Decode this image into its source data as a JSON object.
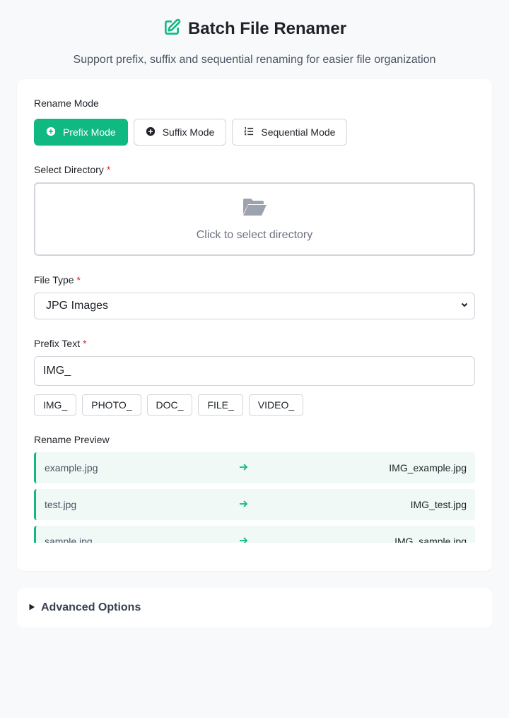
{
  "header": {
    "title": "Batch File Renamer",
    "subtitle": "Support prefix, suffix and sequential renaming for easier file organization",
    "icon": "edit-icon"
  },
  "colors": {
    "accent": "#10b981",
    "required": "#e02424",
    "preview_bg": "#f0f9f5"
  },
  "rename_mode": {
    "label": "Rename Mode",
    "options": [
      {
        "label": "Prefix Mode",
        "icon": "plus-circle-icon",
        "active": true
      },
      {
        "label": "Suffix Mode",
        "icon": "plus-circle-icon",
        "active": false
      },
      {
        "label": "Sequential Mode",
        "icon": "list-ordered-icon",
        "active": false
      }
    ]
  },
  "directory": {
    "label": "Select Directory",
    "required_mark": "*",
    "prompt": "Click to select directory",
    "icon": "folder-open-icon"
  },
  "file_type": {
    "label": "File Type",
    "required_mark": "*",
    "selected": "JPG Images"
  },
  "prefix": {
    "label": "Prefix Text",
    "required_mark": "*",
    "value": "IMG_",
    "suggestions": [
      "IMG_",
      "PHOTO_",
      "DOC_",
      "FILE_",
      "VIDEO_"
    ]
  },
  "preview": {
    "label": "Rename Preview",
    "rows": [
      {
        "old": "example.jpg",
        "new": "IMG_example.jpg"
      },
      {
        "old": "test.jpg",
        "new": "IMG_test.jpg"
      },
      {
        "old": "sample.jpg",
        "new": "IMG_sample.jpg"
      }
    ]
  },
  "advanced": {
    "label": "Advanced Options"
  }
}
